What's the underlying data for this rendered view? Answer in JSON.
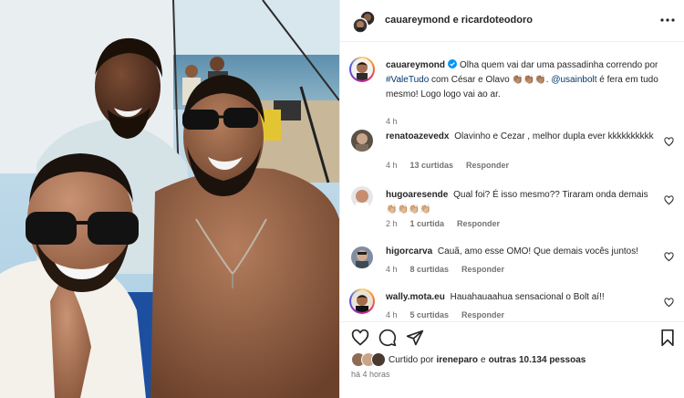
{
  "header": {
    "names": "cauareymond e ricardoteodoro"
  },
  "caption": {
    "user": "cauareymond",
    "verified": true,
    "text_1": "Olha quem vai dar uma passadinha correndo por",
    "hashtag": "#ValeTudo",
    "text_2": "com César e Olavo 👏🏽👏🏽👏🏽.",
    "mention": "@usainbolt",
    "text_3": "é fera em tudo mesmo! Logo logo vai ao ar.",
    "time": "4 h"
  },
  "comments": [
    {
      "user": "renatoazevedx",
      "text": "Olavinho e Cezar , melhor dupla ever kkkkkkkkkk",
      "time": "4 h",
      "likes": "13 curtidas",
      "reply": "Responder"
    },
    {
      "user": "hugoaresende",
      "text": "Qual foi? É isso mesmo?? Tiraram onda demais 👏🏼👏🏼👏🏼👏🏼",
      "time": "2 h",
      "likes": "1 curtida",
      "reply": "Responder"
    },
    {
      "user": "higorcarva",
      "text": "Cauã, amo esse OMO! Que demais vocês juntos!",
      "time": "4 h",
      "likes": "8 curtidas",
      "reply": "Responder"
    },
    {
      "user": "wally.mota.eu",
      "text": "Hauahauaahua sensacional o Bolt aí!!",
      "time": "4 h",
      "likes": "5 curtidas",
      "reply": "Responder"
    }
  ],
  "likes": {
    "prefix": "Curtido por",
    "user": "ireneparo",
    "middle": "e",
    "others": "outras 10.134 pessoas"
  },
  "posted": "há 4 horas",
  "icons": {
    "like": "heart-icon",
    "comment": "comment-icon",
    "share": "send-icon",
    "save": "bookmark-icon",
    "more": "more-icon",
    "verified": "verified-badge-icon"
  },
  "colors": {
    "link": "#00376b",
    "verified": "#0095f6",
    "muted": "#737373"
  }
}
